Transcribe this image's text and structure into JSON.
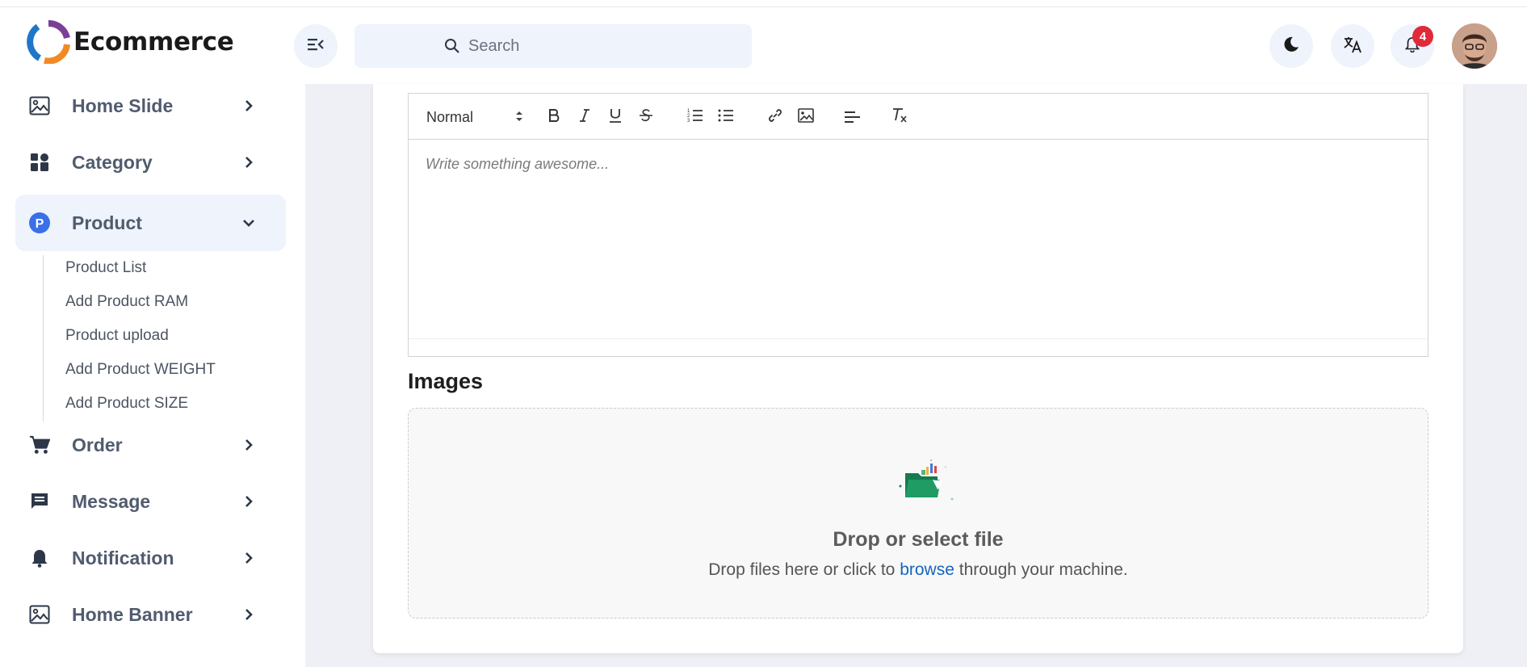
{
  "app": {
    "name": "Ecommerce"
  },
  "header": {
    "search_placeholder": "Search",
    "notification_count": "4"
  },
  "sidebar": {
    "items": [
      {
        "label": "Home Slide",
        "icon": "image-icon",
        "expanded": false
      },
      {
        "label": "Category",
        "icon": "category-grid-icon",
        "expanded": false
      },
      {
        "label": "Product",
        "icon": "product-p-icon",
        "expanded": true
      },
      {
        "label": "Order",
        "icon": "cart-icon",
        "expanded": false
      },
      {
        "label": "Message",
        "icon": "message-icon",
        "expanded": false
      },
      {
        "label": "Notification",
        "icon": "bell-icon",
        "expanded": false
      },
      {
        "label": "Home Banner",
        "icon": "image-icon",
        "expanded": false
      }
    ],
    "product_subitems": [
      "Product List",
      "Add Product RAM",
      "Product upload",
      "Add Product WEIGHT",
      "Add Product SIZE"
    ]
  },
  "editor": {
    "format_select": "Normal",
    "toolbar_buttons": [
      "bold",
      "italic",
      "underline",
      "strikethrough",
      "ordered-list",
      "bullet-list",
      "link",
      "image",
      "align",
      "clean-format"
    ],
    "placeholder": "Write something awesome..."
  },
  "images": {
    "title": "Images",
    "drop_title": "Drop or select file",
    "drop_desc_before": "Drop files here or click to",
    "drop_link": "browse",
    "drop_desc_after": "through your machine."
  },
  "colors": {
    "accent": "#3b82f6",
    "active_bg": "#eef3fc",
    "badge": "#e0293a",
    "link": "#1565c0",
    "main_bg": "#eef0f5"
  }
}
